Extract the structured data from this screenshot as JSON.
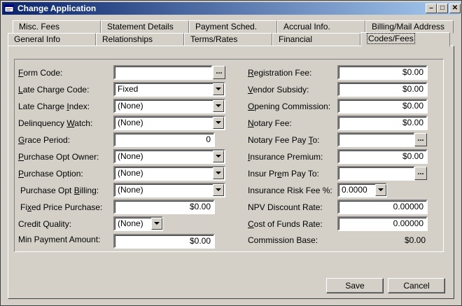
{
  "window": {
    "title": "Change Application"
  },
  "tabs_back": [
    {
      "label": "Misc. Fees"
    },
    {
      "label": "Statement Details"
    },
    {
      "label": "Payment Sched."
    },
    {
      "label": "Accrual Info."
    },
    {
      "label": "Billing/Mail Address"
    }
  ],
  "tabs_front": [
    {
      "label": "General Info"
    },
    {
      "label": "Relationships"
    },
    {
      "label": "Terms/Rates"
    },
    {
      "label": "Financial"
    },
    {
      "label": "Codes/Fees",
      "active": true
    }
  ],
  "left": {
    "form_code": {
      "label_pre": "",
      "label_u": "F",
      "label_post": "orm Code:",
      "value": ""
    },
    "late_charge_code": {
      "label_pre": "",
      "label_u": "L",
      "label_post": "ate Charge Code:",
      "value": "Fixed"
    },
    "late_charge_index": {
      "label_pre": "Late Charge ",
      "label_u": "I",
      "label_post": "ndex:",
      "value": "(None)"
    },
    "delinquency_watch": {
      "label_pre": "Delinquency ",
      "label_u": "W",
      "label_post": "atch:",
      "value": "(None)"
    },
    "grace_period": {
      "label_pre": "",
      "label_u": "G",
      "label_post": "race Period:",
      "value": "0"
    },
    "purchase_opt_owner": {
      "label_pre": "",
      "label_u": "P",
      "label_post": "urchase Opt Owner:",
      "value": "(None)"
    },
    "purchase_option": {
      "label_pre": "",
      "label_u": "P",
      "label_post": "urchase Option:",
      "value": "(None)"
    },
    "purchase_opt_billing": {
      "label_pre": "Purchase Opt ",
      "label_u": "B",
      "label_post": "illing:",
      "value": "(None)"
    },
    "fixed_price_purchase": {
      "label_pre": "Fi",
      "label_u": "x",
      "label_post": "ed Price Purchase:",
      "value": "$0.00"
    },
    "credit_quality": {
      "label_pre": "Credit Quality:",
      "label_u": "",
      "label_post": "",
      "value": "(None)"
    },
    "min_payment_amount": {
      "label_pre": "Min Payment Amount:",
      "label_u": "",
      "label_post": "",
      "value": "$0.00"
    }
  },
  "right": {
    "registration_fee": {
      "label_pre": "",
      "label_u": "R",
      "label_post": "egistration Fee:",
      "value": "$0.00"
    },
    "vendor_subsidy": {
      "label_pre": "",
      "label_u": "V",
      "label_post": "endor Subsidy:",
      "value": "$0.00"
    },
    "opening_commission": {
      "label_pre": "",
      "label_u": "O",
      "label_post": "pening Commission:",
      "value": "$0.00"
    },
    "notary_fee": {
      "label_pre": "",
      "label_u": "N",
      "label_post": "otary Fee:",
      "value": "$0.00"
    },
    "notary_fee_pay_to": {
      "label_pre": "Notary Fee Pay ",
      "label_u": "T",
      "label_post": "o:",
      "value": ""
    },
    "insurance_premium": {
      "label_pre": "",
      "label_u": "I",
      "label_post": "nsurance Premium:",
      "value": "$0.00"
    },
    "insur_prem_pay_to": {
      "label_pre": "Insur Pr",
      "label_u": "e",
      "label_post": "m Pay To:",
      "value": ""
    },
    "insurance_risk_fee": {
      "label_pre": "Insurance Risk Fee %:",
      "label_u": "",
      "label_post": "",
      "value": "0.0000"
    },
    "npv_discount_rate": {
      "label_pre": "NPV Discount Rate:",
      "label_u": "",
      "label_post": "",
      "value": "0.00000"
    },
    "cost_of_funds_rate": {
      "label_pre": "",
      "label_u": "C",
      "label_post": "ost of Funds Rate:",
      "value": "0.00000"
    },
    "commission_base": {
      "label_pre": "Commission Base:",
      "label_u": "",
      "label_post": "",
      "value": "$0.00"
    }
  },
  "buttons": {
    "save": "Save",
    "cancel": "Cancel",
    "ellipsis": "..."
  }
}
